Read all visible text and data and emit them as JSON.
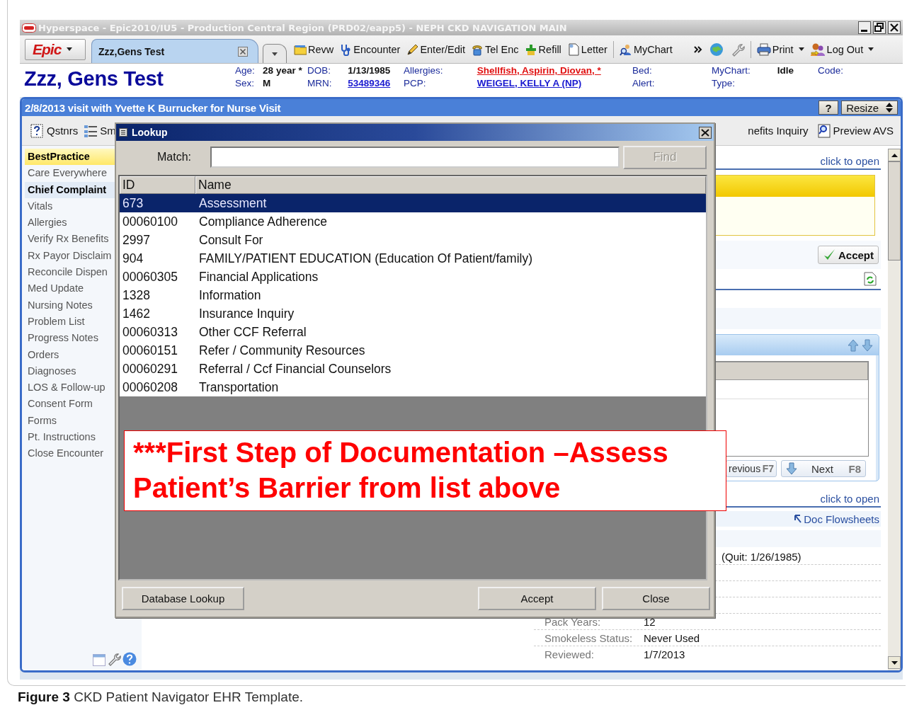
{
  "window": {
    "title": "Hyperspace - Epic2010/IU5 - Production Central Region (PRD02/eapp5) - NEPH CKD NAVIGATION MAIN"
  },
  "toolbar": {
    "epic_button": "Epic",
    "patient_tab": "Zzz,Gens Test",
    "buttons": [
      "Revw",
      "Encounter",
      "Enter/Edit",
      "Tel Enc",
      "Refill",
      "Letter",
      "MyChart"
    ],
    "menus": [
      "Print",
      "Log Out"
    ]
  },
  "patient": {
    "name": "Zzz, Gens Test",
    "columns": [
      [
        {
          "label": "Age:",
          "value": "28 year *",
          "kind": "bold"
        },
        {
          "label": "Sex:",
          "value": "M",
          "kind": "bold"
        }
      ],
      [
        {
          "label": "DOB:",
          "value": "1/13/1985",
          "kind": "bold"
        },
        {
          "label": "MRN:",
          "value": "53489346",
          "kind": "link"
        }
      ],
      [
        {
          "label": "Allergies:",
          "value": "Shellfish, Aspirin, Diovan, *",
          "kind": "alert"
        },
        {
          "label": "PCP:",
          "value": "WEIGEL, KELLY A (NP)",
          "kind": "link"
        }
      ],
      [
        {
          "label": "Bed:"
        },
        {
          "label": "Alert:"
        }
      ],
      [
        {
          "label": "MyChart:",
          "value": "Idle",
          "kind": "bold"
        },
        {
          "label": "Type:"
        }
      ],
      [
        {
          "label": "Code:"
        }
      ]
    ]
  },
  "visit_bar": {
    "title": "2/8/2013 visit with Yvette K Burrucker for Nurse Visit",
    "help": "?",
    "resize": "Resize"
  },
  "activity_bar": {
    "left": [
      "Qstnrs",
      "Sm"
    ],
    "right": [
      "nefits Inquiry",
      "Preview AVS"
    ]
  },
  "sidebar": {
    "items": [
      {
        "label": "BestPractice",
        "kind": "alert",
        "selected": false
      },
      {
        "label": "Care Everywhere",
        "kind": "section",
        "selected": false
      },
      {
        "label": "Chief Complaint",
        "kind": "section",
        "selected": true
      },
      {
        "label": "Vitals",
        "kind": "section",
        "selected": false
      },
      {
        "label": "Allergies",
        "kind": "section",
        "selected": false
      },
      {
        "label": "Verify Rx Benefits",
        "kind": "section",
        "selected": false
      },
      {
        "label": "Rx Payor Disclaim",
        "kind": "section",
        "selected": false
      },
      {
        "label": "Reconcile Dispen",
        "kind": "section",
        "selected": false
      },
      {
        "label": "Med Update",
        "kind": "section",
        "selected": false
      },
      {
        "label": "Nursing Notes",
        "kind": "section",
        "selected": false
      },
      {
        "label": "Problem List",
        "kind": "section",
        "selected": false
      },
      {
        "label": "Progress Notes",
        "kind": "section",
        "selected": false
      },
      {
        "label": "Orders",
        "kind": "section",
        "selected": false
      },
      {
        "label": "Diagnoses",
        "kind": "section",
        "selected": false
      },
      {
        "label": "LOS & Follow-up",
        "kind": "section",
        "selected": false
      },
      {
        "label": "Consent Form",
        "kind": "section",
        "selected": false
      },
      {
        "label": "Forms",
        "kind": "section",
        "selected": false
      },
      {
        "label": "Pt. Instructions",
        "kind": "section",
        "selected": false
      },
      {
        "label": "Close Encounter",
        "kind": "section",
        "selected": false
      }
    ]
  },
  "main": {
    "open_link_top": "click to open",
    "accept_button": "Accept",
    "navigator": {
      "previous": {
        "label": "revious",
        "key": "F7"
      },
      "next": {
        "label": "Next",
        "key": "F8"
      }
    },
    "open_link_bottom": "click to open",
    "flowsheets_link": "Doc Flowsheets",
    "quit_note": "(Quit: 1/26/1985)",
    "history": [
      {
        "label": "Pack Years:",
        "value": "12"
      },
      {
        "label": "Smokeless Status:",
        "value": "Never Used"
      },
      {
        "label": "Reviewed:",
        "value": "1/7/2013"
      }
    ]
  },
  "lookup": {
    "title": "Lookup",
    "match_label": "Match:",
    "find_button": {
      "label": "Find",
      "disabled": true
    },
    "columns": [
      "ID",
      "Name"
    ],
    "rows": [
      {
        "id": "673",
        "name": "Assessment",
        "selected": true
      },
      {
        "id": "00060100",
        "name": "Compliance Adherence",
        "selected": false
      },
      {
        "id": "2997",
        "name": "Consult For",
        "selected": false
      },
      {
        "id": "904",
        "name": "FAMILY/PATIENT EDUCATION (Education Of Patient/family)",
        "selected": false
      },
      {
        "id": "00060305",
        "name": "Financial Applications",
        "selected": false
      },
      {
        "id": "1328",
        "name": "Information",
        "selected": false
      },
      {
        "id": "1462",
        "name": "Insurance Inquiry",
        "selected": false
      },
      {
        "id": "00060313",
        "name": "Other CCF Referral",
        "selected": false
      },
      {
        "id": "00060151",
        "name": "Refer / Community Resources",
        "selected": false
      },
      {
        "id": "00060291",
        "name": "Referral / Ccf Financial Counselors",
        "selected": false
      },
      {
        "id": "00060208",
        "name": "Transportation",
        "selected": false
      }
    ],
    "buttons": [
      "Database Lookup",
      "Accept",
      "Close"
    ]
  },
  "callout": {
    "text": "***First Step of Documentation –Assess Patient’s Barrier from list above"
  },
  "caption": {
    "text": "**Figure 3** CKD Patient Navigator EHR Template."
  }
}
